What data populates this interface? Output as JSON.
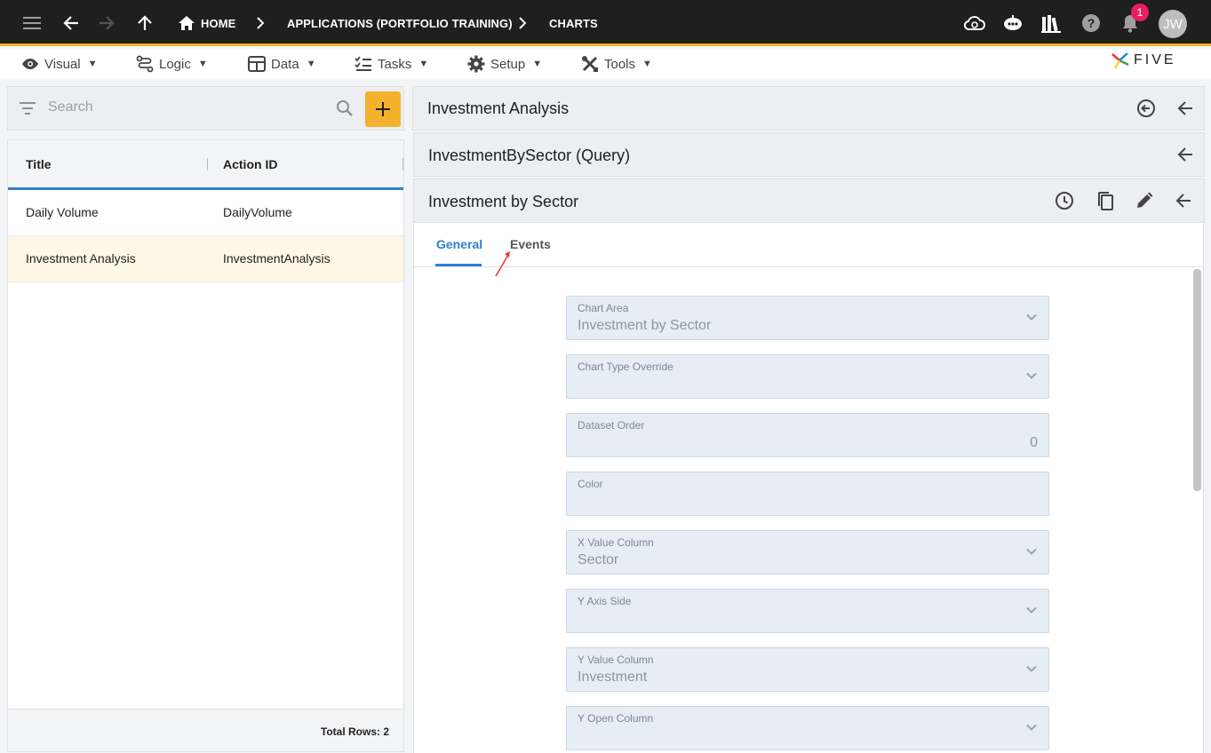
{
  "appbar": {
    "breadcrumbs": [
      "HOME",
      "APPLICATIONS (PORTFOLIO TRAINING)",
      "CHARTS"
    ],
    "notification_count": "1",
    "avatar_initials": "JW"
  },
  "menubar": {
    "items": [
      {
        "label": "Visual",
        "icon": "eye-icon"
      },
      {
        "label": "Logic",
        "icon": "logic-icon"
      },
      {
        "label": "Data",
        "icon": "table-icon"
      },
      {
        "label": "Tasks",
        "icon": "checklist-icon"
      },
      {
        "label": "Setup",
        "icon": "gear-icon"
      },
      {
        "label": "Tools",
        "icon": "tools-icon"
      }
    ],
    "caret": "▼",
    "brand": "FIVE"
  },
  "left": {
    "search_placeholder": "Search",
    "columns": [
      "Title",
      "Action ID"
    ],
    "rows": [
      {
        "title": "Daily Volume",
        "action_id": "DailyVolume"
      },
      {
        "title": "Investment Analysis",
        "action_id": "InvestmentAnalysis"
      }
    ],
    "total_rows": "Total Rows: 2"
  },
  "right": {
    "level1_title": "Investment Analysis",
    "level2_title": "InvestmentBySector (Query)",
    "level3_title": "Investment by Sector",
    "tabs": [
      "General",
      "Events"
    ],
    "fields": [
      {
        "label": "Chart Area",
        "value": "Investment by Sector",
        "type": "select"
      },
      {
        "label": "Chart Type Override",
        "value": "",
        "type": "select"
      },
      {
        "label": "Dataset Order",
        "value": "0",
        "type": "number"
      },
      {
        "label": "Color",
        "value": "",
        "type": "text"
      },
      {
        "label": "X Value Column",
        "value": "Sector",
        "type": "select"
      },
      {
        "label": "Y Axis Side",
        "value": "",
        "type": "select"
      },
      {
        "label": "Y Value Column",
        "value": "Investment",
        "type": "select"
      },
      {
        "label": "Y Open Column",
        "value": "",
        "type": "select"
      }
    ]
  },
  "colors": {
    "accent": "#f3b12c",
    "primary": "#2f7fd1",
    "appbar": "#1f1f1f",
    "badge": "#e91e63"
  }
}
